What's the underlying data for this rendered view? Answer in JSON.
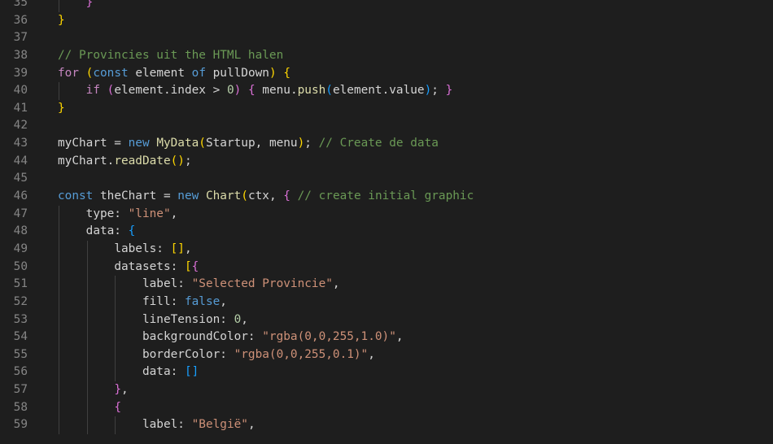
{
  "editor": {
    "colors": {
      "background": "#1e1e1e",
      "line_number": "#858585",
      "text": "#d4d4d4",
      "keyword": "#569cd6",
      "control_keyword": "#c586c0",
      "function": "#dcdcaa",
      "string": "#ce9178",
      "number": "#b5cea8",
      "comment": "#6a9955",
      "bracket_level_1": "#ffd700",
      "bracket_level_2": "#da70d6",
      "bracket_level_3": "#179fff",
      "indent_guide": "#404040"
    },
    "lines": [
      {
        "n": "35",
        "indent": 1,
        "tokens": [
          {
            "t": "    "
          },
          {
            "t": "}",
            "c": "b2"
          }
        ]
      },
      {
        "n": "36",
        "indent": 0,
        "tokens": [
          {
            "t": "}",
            "c": "b1"
          }
        ]
      },
      {
        "n": "37",
        "indent": 0,
        "tokens": []
      },
      {
        "n": "38",
        "indent": 0,
        "tokens": [
          {
            "t": "// Provincies uit the HTML halen",
            "c": "cmt"
          }
        ]
      },
      {
        "n": "39",
        "indent": 0,
        "tokens": [
          {
            "t": "for",
            "c": "ctl"
          },
          {
            "t": " "
          },
          {
            "t": "(",
            "c": "b1"
          },
          {
            "t": "const",
            "c": "kw"
          },
          {
            "t": " element ",
            "c": "var"
          },
          {
            "t": "of",
            "c": "kw"
          },
          {
            "t": " pullDown",
            "c": "var"
          },
          {
            "t": ")",
            "c": "b1"
          },
          {
            "t": " "
          },
          {
            "t": "{",
            "c": "b1"
          }
        ]
      },
      {
        "n": "40",
        "indent": 1,
        "tokens": [
          {
            "t": "    "
          },
          {
            "t": "if",
            "c": "ctl"
          },
          {
            "t": " "
          },
          {
            "t": "(",
            "c": "b2"
          },
          {
            "t": "element.index > ",
            "c": "var"
          },
          {
            "t": "0",
            "c": "num"
          },
          {
            "t": ")",
            "c": "b2"
          },
          {
            "t": " "
          },
          {
            "t": "{",
            "c": "b2"
          },
          {
            "t": " menu.",
            "c": "var"
          },
          {
            "t": "push",
            "c": "fn"
          },
          {
            "t": "(",
            "c": "b3"
          },
          {
            "t": "element.value",
            "c": "var"
          },
          {
            "t": ")",
            "c": "b3"
          },
          {
            "t": "; "
          },
          {
            "t": "}",
            "c": "b2"
          }
        ]
      },
      {
        "n": "41",
        "indent": 0,
        "tokens": [
          {
            "t": "}",
            "c": "b1"
          }
        ]
      },
      {
        "n": "42",
        "indent": 0,
        "tokens": []
      },
      {
        "n": "43",
        "indent": 0,
        "tokens": [
          {
            "t": "myChart = ",
            "c": "var"
          },
          {
            "t": "new",
            "c": "kw"
          },
          {
            "t": " "
          },
          {
            "t": "MyData",
            "c": "fn"
          },
          {
            "t": "(",
            "c": "b1"
          },
          {
            "t": "Startup, menu",
            "c": "var"
          },
          {
            "t": ")",
            "c": "b1"
          },
          {
            "t": "; "
          },
          {
            "t": "// Create de data",
            "c": "cmt"
          }
        ]
      },
      {
        "n": "44",
        "indent": 0,
        "tokens": [
          {
            "t": "myChart.",
            "c": "var"
          },
          {
            "t": "readDate",
            "c": "fn"
          },
          {
            "t": "(",
            "c": "b1"
          },
          {
            "t": ")",
            "c": "b1"
          },
          {
            "t": ";"
          }
        ]
      },
      {
        "n": "45",
        "indent": 0,
        "tokens": []
      },
      {
        "n": "46",
        "indent": 0,
        "tokens": [
          {
            "t": "const",
            "c": "kw"
          },
          {
            "t": " theChart = ",
            "c": "var"
          },
          {
            "t": "new",
            "c": "kw"
          },
          {
            "t": " "
          },
          {
            "t": "Chart",
            "c": "fn"
          },
          {
            "t": "(",
            "c": "b1"
          },
          {
            "t": "ctx, ",
            "c": "var"
          },
          {
            "t": "{",
            "c": "b2"
          },
          {
            "t": " "
          },
          {
            "t": "// create initial graphic",
            "c": "cmt"
          }
        ]
      },
      {
        "n": "47",
        "indent": 1,
        "tokens": [
          {
            "t": "    "
          },
          {
            "t": "type: ",
            "c": "prop"
          },
          {
            "t": "\"line\"",
            "c": "str"
          },
          {
            "t": ","
          }
        ]
      },
      {
        "n": "48",
        "indent": 1,
        "tokens": [
          {
            "t": "    "
          },
          {
            "t": "data: ",
            "c": "prop"
          },
          {
            "t": "{",
            "c": "b3"
          }
        ]
      },
      {
        "n": "49",
        "indent": 2,
        "tokens": [
          {
            "t": "        "
          },
          {
            "t": "labels: ",
            "c": "prop"
          },
          {
            "t": "[",
            "c": "b1"
          },
          {
            "t": "]",
            "c": "b1"
          },
          {
            "t": ","
          }
        ]
      },
      {
        "n": "50",
        "indent": 2,
        "tokens": [
          {
            "t": "        "
          },
          {
            "t": "datasets: ",
            "c": "prop"
          },
          {
            "t": "[",
            "c": "b1"
          },
          {
            "t": "{",
            "c": "b2"
          }
        ]
      },
      {
        "n": "51",
        "indent": 3,
        "tokens": [
          {
            "t": "            "
          },
          {
            "t": "label: ",
            "c": "prop"
          },
          {
            "t": "\"Selected Provincie\"",
            "c": "str"
          },
          {
            "t": ","
          }
        ]
      },
      {
        "n": "52",
        "indent": 3,
        "tokens": [
          {
            "t": "            "
          },
          {
            "t": "fill: ",
            "c": "prop"
          },
          {
            "t": "false",
            "c": "lit"
          },
          {
            "t": ","
          }
        ]
      },
      {
        "n": "53",
        "indent": 3,
        "tokens": [
          {
            "t": "            "
          },
          {
            "t": "lineTension: ",
            "c": "prop"
          },
          {
            "t": "0",
            "c": "num"
          },
          {
            "t": ","
          }
        ]
      },
      {
        "n": "54",
        "indent": 3,
        "tokens": [
          {
            "t": "            "
          },
          {
            "t": "backgroundColor: ",
            "c": "prop"
          },
          {
            "t": "\"rgba(0,0,255,1.0)\"",
            "c": "str"
          },
          {
            "t": ","
          }
        ]
      },
      {
        "n": "55",
        "indent": 3,
        "tokens": [
          {
            "t": "            "
          },
          {
            "t": "borderColor: ",
            "c": "prop"
          },
          {
            "t": "\"rgba(0,0,255,0.1)\"",
            "c": "str"
          },
          {
            "t": ","
          }
        ]
      },
      {
        "n": "56",
        "indent": 3,
        "tokens": [
          {
            "t": "            "
          },
          {
            "t": "data: ",
            "c": "prop"
          },
          {
            "t": "[",
            "c": "b3"
          },
          {
            "t": "]",
            "c": "b3"
          }
        ]
      },
      {
        "n": "57",
        "indent": 2,
        "tokens": [
          {
            "t": "        "
          },
          {
            "t": "}",
            "c": "b2"
          },
          {
            "t": ","
          }
        ]
      },
      {
        "n": "58",
        "indent": 2,
        "tokens": [
          {
            "t": "        "
          },
          {
            "t": "{",
            "c": "b2"
          }
        ]
      },
      {
        "n": "59",
        "indent": 3,
        "tokens": [
          {
            "t": "            "
          },
          {
            "t": "label: ",
            "c": "prop"
          },
          {
            "t": "\"België\"",
            "c": "str"
          },
          {
            "t": ","
          }
        ]
      }
    ]
  }
}
